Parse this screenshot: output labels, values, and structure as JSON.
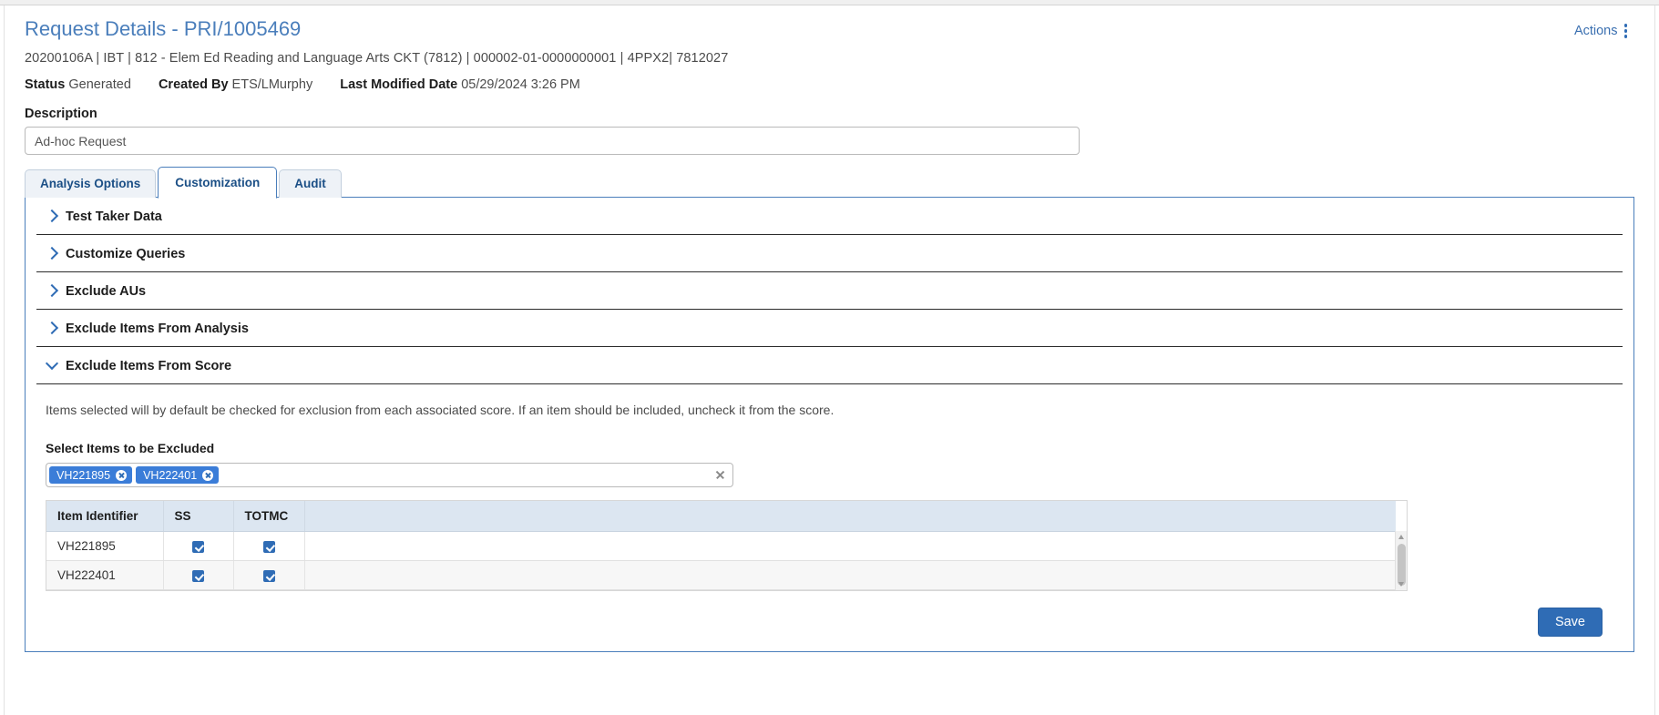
{
  "header": {
    "title": "Request Details - PRI/1005469",
    "actions_label": "Actions",
    "meta_line": "20200106A | IBT | 812 - Elem Ed Reading and Language Arts CKT (7812) | 000002-01-0000000001 | 4PPX2| 7812027",
    "status_label": "Status",
    "status_value": "Generated",
    "created_by_label": "Created By",
    "created_by_value": "ETS/LMurphy",
    "last_modified_label": "Last Modified Date",
    "last_modified_value": "05/29/2024 3:26 PM"
  },
  "description": {
    "label": "Description",
    "value": "Ad-hoc Request",
    "placeholder": "Description"
  },
  "tabs": [
    {
      "label": "Analysis Options",
      "active": false
    },
    {
      "label": "Customization",
      "active": true
    },
    {
      "label": "Audit",
      "active": false
    }
  ],
  "accordion": [
    {
      "label": "Test Taker Data",
      "expanded": false
    },
    {
      "label": "Customize Queries",
      "expanded": false
    },
    {
      "label": "Exclude AUs",
      "expanded": false
    },
    {
      "label": "Exclude Items From Analysis",
      "expanded": false
    },
    {
      "label": "Exclude Items From Score",
      "expanded": true
    }
  ],
  "exclude_section": {
    "helper_text": "Items selected will by default be checked for exclusion from each associated score. If an item should be included, uncheck it from the score.",
    "select_label": "Select Items to be Excluded",
    "chips": [
      "VH221895",
      "VH222401"
    ],
    "table": {
      "columns": [
        "Item Identifier",
        "SS",
        "TOTMC",
        ""
      ],
      "rows": [
        {
          "item": "VH221895",
          "ss": true,
          "totmc": true
        },
        {
          "item": "VH222401",
          "ss": true,
          "totmc": true
        }
      ]
    }
  },
  "footer": {
    "save_label": "Save"
  },
  "colors": {
    "accent": "#2f6cb5",
    "title": "#4a7ebb",
    "tab_border": "#4a7ebb",
    "chip_bg": "#3b7dd8",
    "table_header_bg": "#dce6f1",
    "save_bg": "#2f6cb5"
  }
}
